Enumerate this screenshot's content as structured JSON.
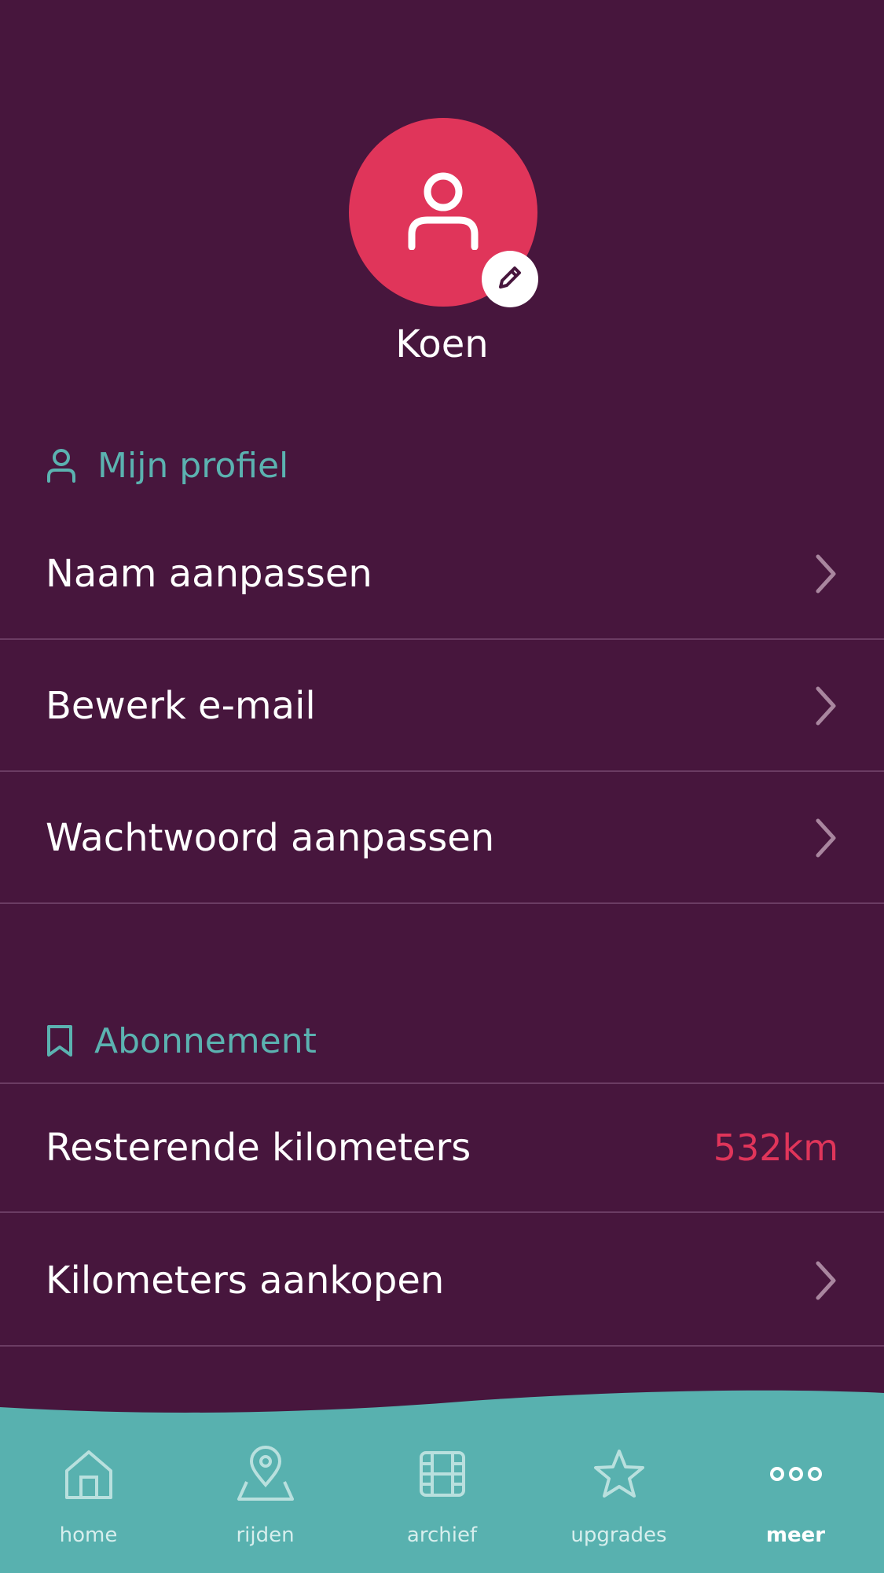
{
  "profile": {
    "name": "Koen",
    "avatar_icon": "user-icon",
    "edit_icon": "pencil-icon",
    "avatar_color": "#e0355a"
  },
  "sections": {
    "profile": {
      "title": "Mijn profiel",
      "icon": "user-icon",
      "items": [
        {
          "label": "Naam aanpassen"
        },
        {
          "label": "Bewerk e-mail"
        },
        {
          "label": "Wachtwoord aanpassen"
        }
      ]
    },
    "subscription": {
      "title": "Abonnement",
      "icon": "bookmark-icon",
      "items": [
        {
          "label": "Resterende kilometers",
          "value": "532km"
        },
        {
          "label": "Kilometers aankopen"
        }
      ]
    }
  },
  "tabbar": {
    "tabs": [
      {
        "label": "home",
        "icon": "home-icon"
      },
      {
        "label": "rijden",
        "icon": "map-pin-icon"
      },
      {
        "label": "archief",
        "icon": "film-icon"
      },
      {
        "label": "upgrades",
        "icon": "star-icon"
      },
      {
        "label": "meer",
        "icon": "more-dots-icon",
        "active": true
      }
    ]
  },
  "colors": {
    "background": "#47163d",
    "accent": "#e0355a",
    "teal": "#5bb2b0",
    "divider": "#6b3c63"
  }
}
